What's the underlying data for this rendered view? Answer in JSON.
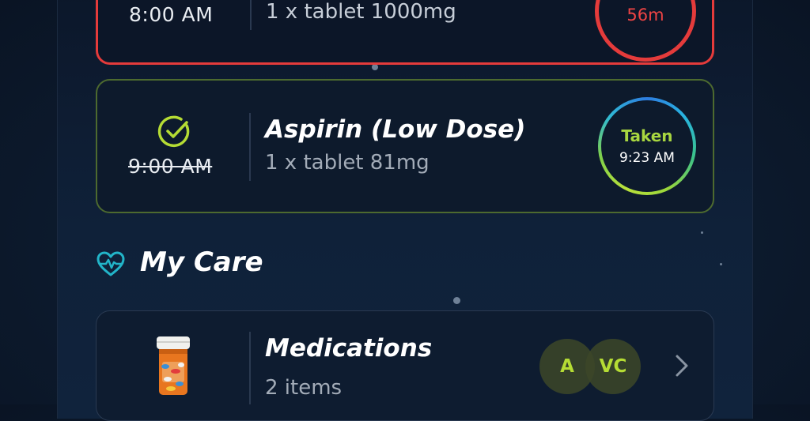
{
  "schedule": {
    "overdue": {
      "time": "8:00 AM",
      "dose": "1 x tablet 1000mg",
      "countdown": "56m",
      "status_color": "#e53b3b"
    },
    "taken": {
      "time": "9:00 AM",
      "drug_name": "Aspirin (Low Dose)",
      "dose": "1 x tablet 81mg",
      "status_label": "Taken",
      "taken_time": "9:23 AM",
      "status_color": "#a8d640"
    }
  },
  "my_care": {
    "title": "My Care",
    "icon": "heart-pulse-icon",
    "accent": "#22b5c9",
    "medications": {
      "title": "Medications",
      "count": "2 items",
      "icon": "pill-bottle-icon",
      "avatars": [
        "A",
        "VC"
      ]
    }
  }
}
